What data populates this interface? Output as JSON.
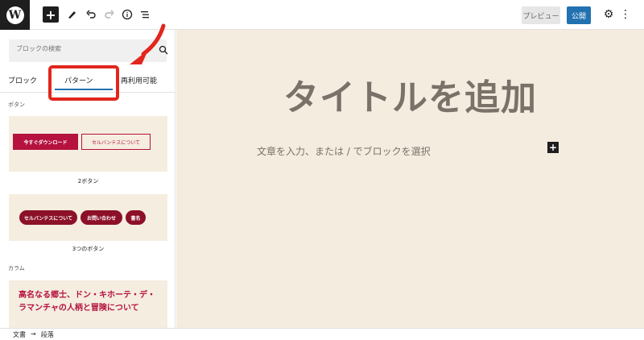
{
  "toolbar": {
    "preview_label": "プレビュー",
    "publish_label": "公開"
  },
  "sidebar": {
    "search_placeholder": "ブロックの検索",
    "tabs": [
      {
        "label": "ブロック"
      },
      {
        "label": "パターン"
      },
      {
        "label": "再利用可能"
      }
    ],
    "categories": {
      "buttons": "ボタン",
      "columns": "カラム"
    },
    "patterns": [
      {
        "name": "2ボタン",
        "buttons": [
          "今すぐダウンロード",
          "セルバンテスについて"
        ]
      },
      {
        "name": "3つのボタン",
        "buttons": [
          "セルバンテスについて",
          "お問い合わせ",
          "書名"
        ]
      },
      {
        "title": "高名なる郷士、ドン・キホーテ・デ・ラマンチャの人柄と冒険について"
      }
    ]
  },
  "canvas": {
    "title": "タイトルを追加",
    "body_placeholder": "文章を入力、または / でブロックを選択"
  },
  "footer": {
    "breadcrumb": [
      "文書",
      "→",
      "段落"
    ]
  },
  "colors": {
    "accent": "#2271b1",
    "highlight": "#e2261d",
    "canvas_bg": "#f4ecdf",
    "pattern_button": "#b5123f"
  }
}
